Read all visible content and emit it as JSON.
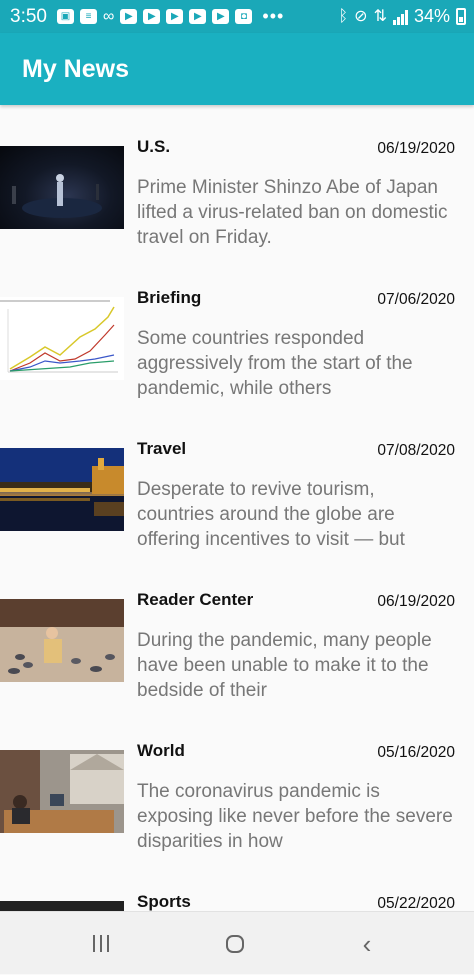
{
  "status_bar": {
    "time": "3:50",
    "battery": "34%",
    "icons": [
      "photo-icon",
      "app-icon",
      "voicemail-icon",
      "youtube-icon",
      "youtube-icon",
      "youtube-icon",
      "youtube-icon",
      "youtube-icon",
      "app-icon",
      "more-dots-icon",
      "bluetooth-icon",
      "mute-icon",
      "data-icon",
      "signal-icon",
      "battery-icon"
    ]
  },
  "app_bar": {
    "title": "My News"
  },
  "articles": [
    {
      "section": "U.S.",
      "date": "06/19/2020",
      "abstract": "Prime Minister Shinzo Abe of Japan lifted a virus-related ban on domestic travel on Friday."
    },
    {
      "section": "Briefing",
      "date": "07/06/2020",
      "abstract": "Some countries responded aggressively from the start of the pandemic, while others"
    },
    {
      "section": "Travel",
      "date": "07/08/2020",
      "abstract": "Desperate to revive tourism, countries around the globe are offering incentives to visit — but"
    },
    {
      "section": "Reader Center",
      "date": "06/19/2020",
      "abstract": "During the pandemic, many people have been unable to make it to the bedside of their"
    },
    {
      "section": "World",
      "date": "05/16/2020",
      "abstract": "The coronavirus pandemic is exposing like never before the severe disparities in how"
    },
    {
      "section": "Sports",
      "date": "05/22/2020",
      "abstract": ""
    }
  ],
  "nav_bar": {
    "buttons": [
      "recents-icon",
      "home-icon",
      "back-icon"
    ]
  },
  "colors": {
    "status_bar": "#1aa8b8",
    "app_bar": "#1ab0c1",
    "abstract_text": "#777777"
  }
}
